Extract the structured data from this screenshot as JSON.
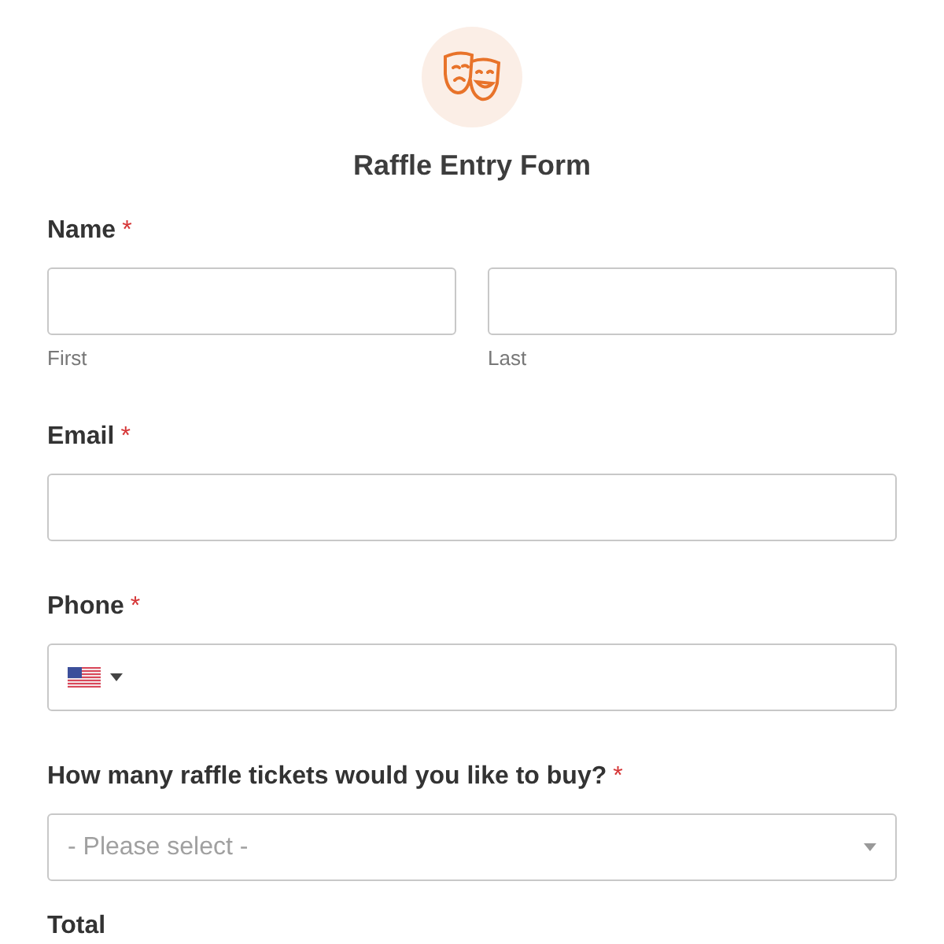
{
  "form": {
    "title": "Raffle Entry Form",
    "required_mark": "*"
  },
  "fields": [
    {
      "kind": "name",
      "label": "Name",
      "required": true,
      "sublabels": [
        "First",
        "Last"
      ]
    },
    {
      "kind": "text",
      "label": "Email",
      "required": true
    },
    {
      "kind": "phone",
      "label": "Phone",
      "required": true
    },
    {
      "kind": "select",
      "label": "How many raffle tickets would you like to buy?",
      "required": true,
      "placeholder": "- Please select -"
    },
    {
      "kind": "total",
      "label": "Total"
    }
  ]
}
